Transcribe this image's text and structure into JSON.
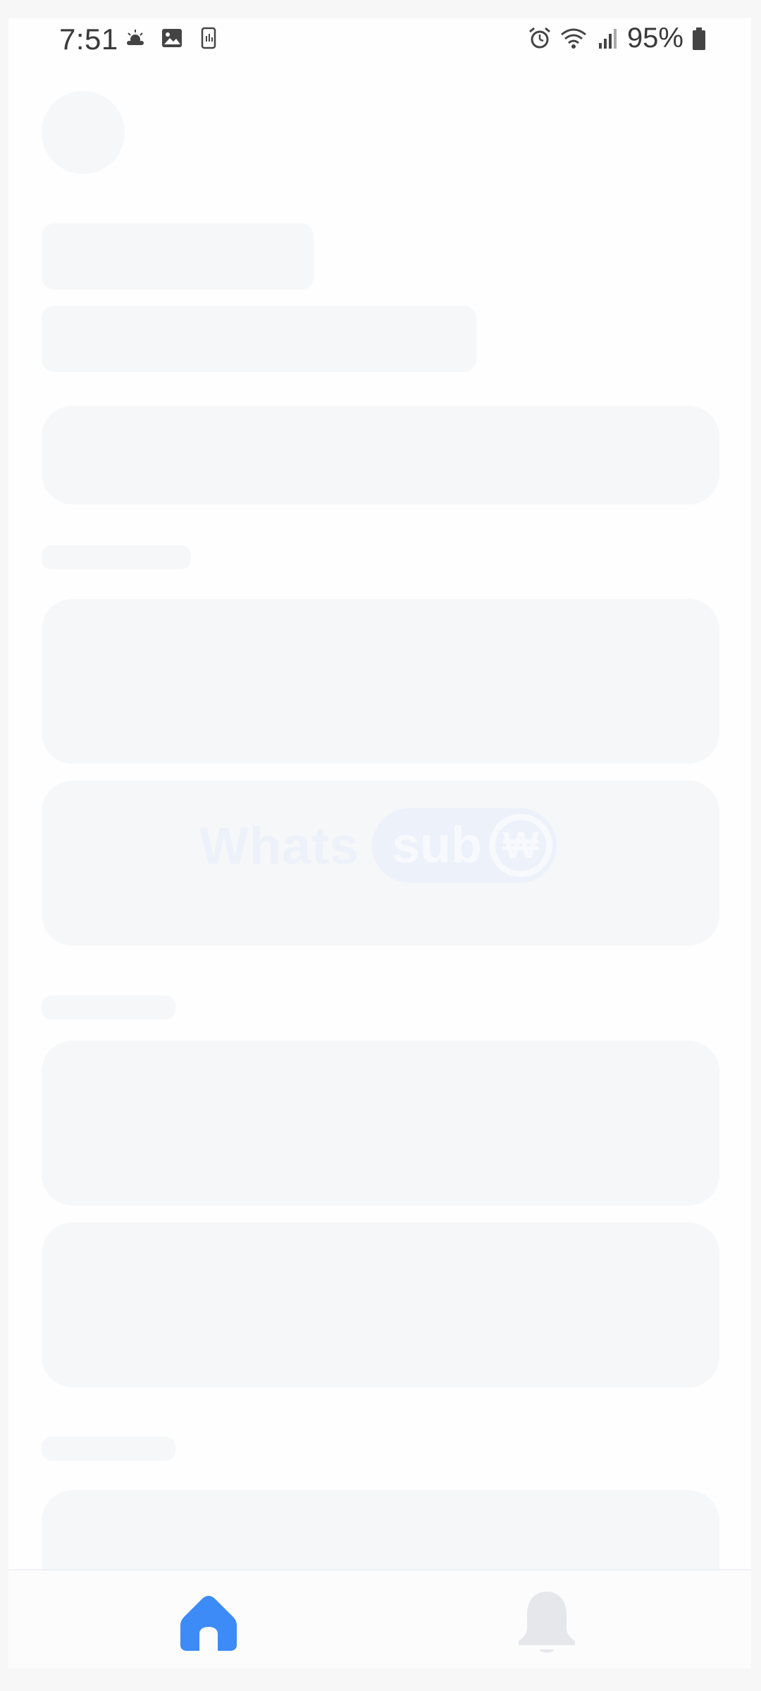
{
  "status_bar": {
    "time": "7:51",
    "battery": "95%",
    "icons_left": [
      "weather-icon",
      "image-icon",
      "phone-icon"
    ],
    "icons_right": [
      "alarm-icon",
      "wifi-icon",
      "signal-icon",
      "battery-icon"
    ]
  },
  "logo": {
    "word": "Whats",
    "pill_text": "sub",
    "coin_symbol": "₩"
  },
  "bottom_nav": {
    "items": [
      {
        "icon": "home-icon",
        "active": true,
        "color": "#3d8bf7"
      },
      {
        "icon": "bell-icon",
        "active": false,
        "color": "#e5e7eb"
      }
    ]
  },
  "colors": {
    "skeleton": "#f6f7f9",
    "accent": "#3d8bf7",
    "background": "#fefefe"
  }
}
